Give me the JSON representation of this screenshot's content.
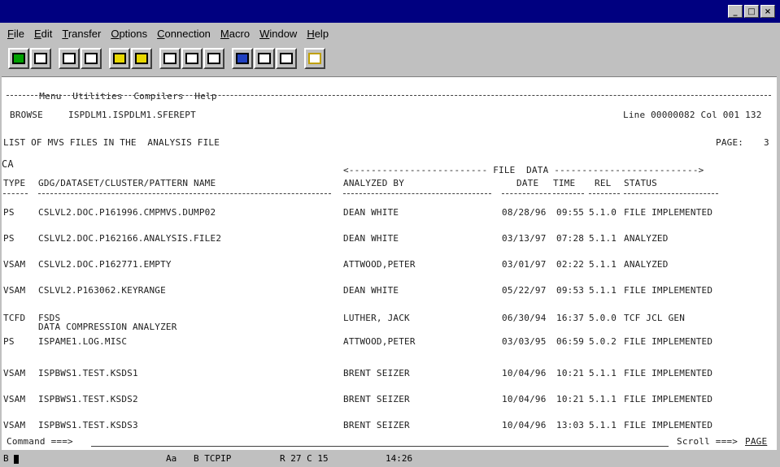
{
  "window": {
    "minimize": "_",
    "maximize": "□",
    "close": "×"
  },
  "menubar": [
    "File",
    "Edit",
    "Transfer",
    "Options",
    "Connection",
    "Macro",
    "Window",
    "Help"
  ],
  "ispf_menu": [
    "Menu",
    "Utilities",
    "Compilers",
    "Help"
  ],
  "browse": {
    "label": "BROWSE",
    "dataset": "ISPDLM1.ISPDLM1.SFEREPT",
    "position": "Line 00000082 Col 001 132"
  },
  "report": {
    "title": "LIST OF MVS FILES IN THE  ANALYSIS FILE",
    "page_label": "PAGE:",
    "page_num": "3",
    "group": "CA",
    "file_data_header": "<------------------------- FILE  DATA -------------------------->",
    "col_type": "TYPE",
    "col_name": "GDG/DATASET/CLUSTER/PATTERN NAME",
    "col_analyzed": "ANALYZED BY",
    "col_date": "DATE",
    "col_time": "TIME",
    "col_rel": "REL",
    "col_status": "STATUS"
  },
  "rows": [
    {
      "type": "PS",
      "name": "CSLVL2.DOC.P161996.CMPMVS.DUMP02",
      "sub": "",
      "analyzed": "DEAN WHITE",
      "date": "08/28/96",
      "time": "09:55",
      "rel": "5.1.0",
      "status": "FILE IMPLEMENTED"
    },
    {
      "type": "PS",
      "name": "CSLVL2.DOC.P162166.ANALYSIS.FILE2",
      "sub": "",
      "analyzed": "DEAN WHITE",
      "date": "03/13/97",
      "time": "07:28",
      "rel": "5.1.1",
      "status": "ANALYZED"
    },
    {
      "type": "VSAM",
      "name": "CSLVL2.DOC.P162771.EMPTY",
      "sub": "",
      "analyzed": "ATTWOOD,PETER",
      "date": "03/01/97",
      "time": "02:22",
      "rel": "5.1.1",
      "status": "ANALYZED"
    },
    {
      "type": "VSAM",
      "name": "CSLVL2.P163062.KEYRANGE",
      "sub": "",
      "analyzed": "DEAN WHITE",
      "date": "05/22/97",
      "time": "09:53",
      "rel": "5.1.1",
      "status": "FILE IMPLEMENTED"
    },
    {
      "type": "TCFD",
      "name": "FSDS",
      "sub": "DATA COMPRESSION ANALYZER",
      "analyzed": "LUTHER, JACK",
      "date": "06/30/94",
      "time": "16:37",
      "rel": "5.0.0",
      "status": "TCF JCL GEN"
    },
    {
      "type": "PS",
      "name": "ISPAME1.LOG.MISC",
      "sub": "",
      "analyzed": "ATTWOOD,PETER",
      "date": "03/03/95",
      "time": "06:59",
      "rel": "5.0.2",
      "status": "FILE IMPLEMENTED"
    },
    {
      "type": "VSAM",
      "name": "ISPBWS1.TEST.KSDS1",
      "sub": "",
      "analyzed": "BRENT SEIZER",
      "date": "10/04/96",
      "time": "10:21",
      "rel": "5.1.1",
      "status": "FILE IMPLEMENTED"
    },
    {
      "type": "VSAM",
      "name": "ISPBWS1.TEST.KSDS2",
      "sub": "",
      "analyzed": "BRENT SEIZER",
      "date": "10/04/96",
      "time": "10:21",
      "rel": "5.1.1",
      "status": "FILE IMPLEMENTED"
    },
    {
      "type": "VSAM",
      "name": "ISPBWS1.TEST.KSDS3",
      "sub": "",
      "analyzed": "BRENT SEIZER",
      "date": "10/04/96",
      "time": "13:03",
      "rel": "5.1.1",
      "status": "FILE IMPLEMENTED"
    }
  ],
  "command": {
    "label": "Command ===>",
    "value": "",
    "scroll_label": "Scroll ===>",
    "scroll_value": "PAGE"
  },
  "status": {
    "mode": "Aa",
    "session": "B TCPIP",
    "cursor": "R 27 C 15",
    "time": "14:26",
    "indicator": "B"
  },
  "colors": {
    "titlebar": "#000080",
    "chrome": "#c0c0c0",
    "screen": "#ffffff"
  },
  "icons": {
    "toolbar": [
      "send-screen-icon",
      "print-icon",
      "copy-icon",
      "paste-icon",
      "receive-file-icon",
      "send-file-icon",
      "quick-macro-icon",
      "record-icon",
      "playback-icon",
      "color-icon",
      "display-setup-icon",
      "clear-icon",
      "help-icon"
    ]
  }
}
